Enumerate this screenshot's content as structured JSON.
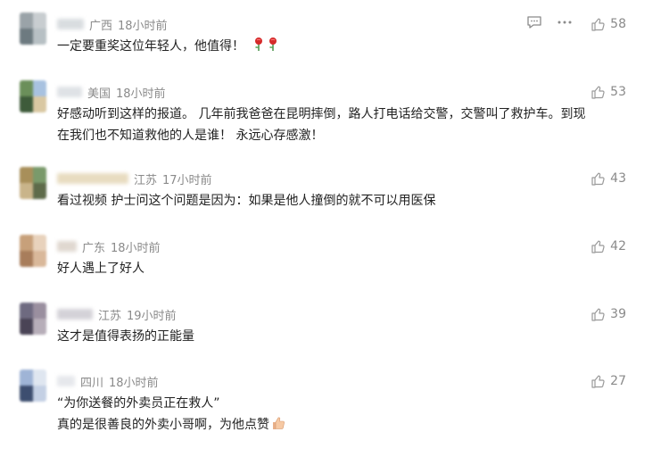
{
  "comments": [
    {
      "location": "广西",
      "time": "18小时前",
      "text": [
        "一定要重奖这位年轻人，他值得！"
      ],
      "emoji": "rose-emoji",
      "likes": "58",
      "colors": {
        "avatar": [
          "#9aa3a8",
          "#c8cdd0",
          "#6d7a80",
          "#b7c0c4"
        ],
        "name": "#d9dde0"
      }
    },
    {
      "location": "美国",
      "time": "18小时前",
      "text": [
        "好感动听到这样的报道。 几年前我爸爸在昆明摔倒，路人打电话给交警，交警叫了救护车。到现",
        "在我们也不知道救他的人是谁！ 永远心存感激！"
      ],
      "likes": "53",
      "colors": {
        "avatar": [
          "#6b8f5a",
          "#a8c2e0",
          "#3e5b3a",
          "#d9c8a2"
        ],
        "name": "#dfe2e6"
      }
    },
    {
      "location": "江苏",
      "time": "17小时前",
      "text": [
        "看过视频 护士问这个问题是因为：如果是他人撞倒的就不可以用医保"
      ],
      "likes": "43",
      "colors": {
        "avatar": [
          "#a88f5a",
          "#7a9a6b",
          "#c9b48a",
          "#5e6b4a"
        ],
        "name": "#e8dcc0"
      }
    },
    {
      "location": "广东",
      "time": "18小时前",
      "text": [
        "好人遇上了好人"
      ],
      "likes": "42",
      "colors": {
        "avatar": [
          "#c7a07a",
          "#e8d2bc",
          "#a87d5b",
          "#d9b89a"
        ],
        "name": "#e0d8d0"
      }
    },
    {
      "location": "江苏",
      "time": "19小时前",
      "text": [
        "这才是值得表扬的正能量"
      ],
      "likes": "39",
      "colors": {
        "avatar": [
          "#6e6a80",
          "#9a8f9f",
          "#4a4456",
          "#b7aeb9"
        ],
        "name": "#d4d2d8"
      }
    },
    {
      "location": "四川",
      "time": "18小时前",
      "text": [
        "“为你送餐的外卖员正在救人”",
        "真的是很善良的外卖小哥啊，为他点赞"
      ],
      "emoji": "thumbs-up-emoji",
      "likes": "27",
      "colors": {
        "avatar": [
          "#9fb4d6",
          "#dfe6f0",
          "#3d4e70",
          "#c4d0e4"
        ],
        "name": "#e6e8ec"
      }
    }
  ]
}
